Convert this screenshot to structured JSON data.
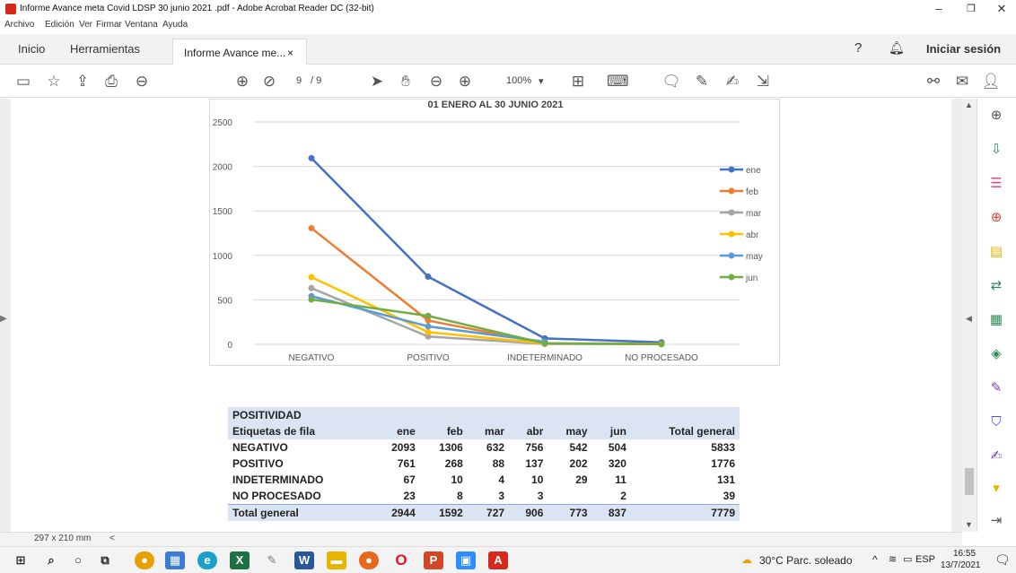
{
  "window": {
    "title": "Informe Avance meta Covid  LDSP 30 junio 2021 .pdf - Adobe Acrobat Reader DC (32-bit)",
    "minimize": "–",
    "maximize": "❐",
    "close": "✕"
  },
  "menu": [
    "Archivo",
    "Edición",
    "Ver",
    "Firmar",
    "Ventana",
    "Ayuda"
  ],
  "tabs": {
    "home": "Inicio",
    "tools": "Herramientas",
    "document": "Informe Avance me...",
    "document_close": "×",
    "sign_in": "Iniciar sesión"
  },
  "toolbar": {
    "current_page": "9",
    "total_pages": "/ 9",
    "zoom": "100%"
  },
  "status": {
    "page_size": "297 x 210 mm",
    "scroll_left": "<"
  },
  "taskbar": {
    "weather": "30°C  Parc. soleado",
    "language": "ESP",
    "time": "16:55",
    "date": "13/7/2021"
  },
  "chart_data": {
    "type": "line",
    "title": "01 ENERO AL 30 JUNIO 2021",
    "categories": [
      "NEGATIVO",
      "POSITIVO",
      "INDETERMINADO",
      "NO PROCESADO"
    ],
    "ylim": [
      0,
      2500
    ],
    "yticks": [
      "0",
      "500",
      "1000",
      "1500",
      "2000",
      "2500"
    ],
    "grid": true,
    "legend_position": "right",
    "series": [
      {
        "name": "ene",
        "color": "#4472c4",
        "values": [
          2093,
          761,
          67,
          23
        ]
      },
      {
        "name": "feb",
        "color": "#ed7d31",
        "values": [
          1306,
          268,
          10,
          8
        ]
      },
      {
        "name": "mar",
        "color": "#a5a5a5",
        "values": [
          632,
          88,
          4,
          3
        ]
      },
      {
        "name": "abr",
        "color": "#ffc000",
        "values": [
          756,
          137,
          10,
          3
        ]
      },
      {
        "name": "may",
        "color": "#5b9bd5",
        "values": [
          542,
          202,
          29,
          null
        ]
      },
      {
        "name": "jun",
        "color": "#70ad47",
        "values": [
          504,
          320,
          11,
          2
        ]
      }
    ]
  },
  "table": {
    "title": "POSITIVIDAD",
    "header": [
      "Etiquetas de fila",
      "ene",
      "feb",
      "mar",
      "abr",
      "may",
      "jun",
      "Total general"
    ],
    "rows": [
      [
        "NEGATIVO",
        "2093",
        "1306",
        "632",
        "756",
        "542",
        "504",
        "5833"
      ],
      [
        "POSITIVO",
        "761",
        "268",
        "88",
        "137",
        "202",
        "320",
        "1776"
      ],
      [
        "INDETERMINADO",
        "67",
        "10",
        "4",
        "10",
        "29",
        "11",
        "131"
      ],
      [
        "NO PROCESADO",
        "23",
        "8",
        "3",
        "3",
        "",
        "2",
        "39"
      ]
    ],
    "total": [
      "Total general",
      "2944",
      "1592",
      "727",
      "906",
      "773",
      "837",
      "7779"
    ]
  }
}
